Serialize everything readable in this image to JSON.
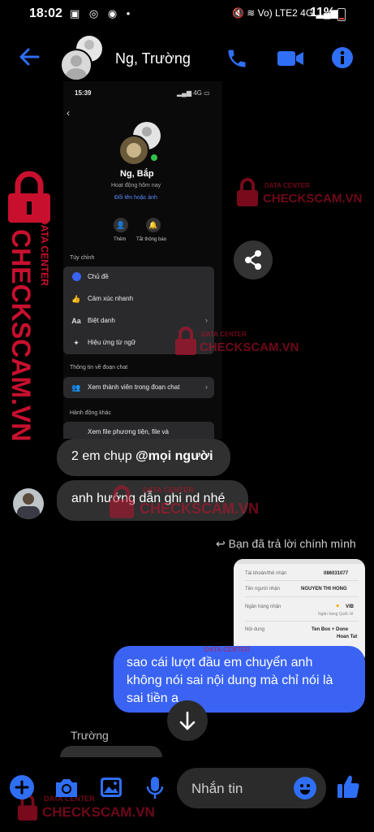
{
  "status_bar": {
    "time": "18:02",
    "network_label": "Vo) LTE2 4G",
    "battery": "11%"
  },
  "header": {
    "contact_name": "Ng, Trường"
  },
  "embedded": {
    "time": "15:39",
    "signal": "4G",
    "profile_name": "Ng, Bắp",
    "status": "Hoạt động hôm nay",
    "rename_link": "Đổi tên hoặc ảnh",
    "add_label": "Thêm",
    "mute_label": "Tắt thông báo",
    "section_customize": "Tùy chỉnh",
    "customize_items": [
      {
        "icon": "theme-icon",
        "label": "Chủ đề"
      },
      {
        "icon": "like-icon",
        "label": "Cảm xúc nhanh"
      },
      {
        "icon": "nickname-icon",
        "label": "Biệt danh",
        "glyph": "Aa"
      },
      {
        "icon": "effects-icon",
        "label": "Hiệu ứng từ ngữ"
      }
    ],
    "section_info": "Thông tin về đoạn chat",
    "members_label": "Xem thành viên trong đoạn chat",
    "section_other": "Hành động khác",
    "media_label": "Xem file phương tiện, file và"
  },
  "messages": {
    "msg1_prefix": "2 em chụp ",
    "msg1_mention": "@mọi người",
    "msg2": "anh hướng dẫn ghi nd nhé",
    "reply_note": "Bạn đã trả lời chính mình",
    "outgoing": [
      "sao cái lượt đầu em chuyển anh",
      "không nói sai nội dung mà chỉ nói là",
      "sai tiền a"
    ],
    "sender_name": "Trường"
  },
  "receipt": {
    "rows": [
      {
        "label": "Tài khoản/thẻ nhận",
        "value": "086031077"
      },
      {
        "label": "Tên người nhận",
        "value": "NGUYEN THI HONG"
      },
      {
        "label": "Ngân hàng nhận",
        "value": "VIB"
      },
      {
        "label": "Nội dung",
        "value": "Ten Box + Done",
        "value2": "Hoan Tat"
      }
    ],
    "bank_sub": "Ngân hàng Quốc tế"
  },
  "composer": {
    "placeholder": "Nhắn tin"
  },
  "watermark": {
    "title": "DATA CENTER",
    "brand": "CHECKSCAM.VN"
  },
  "colors": {
    "accent": "#2f6ff5",
    "outgoing_bubble": "#3a63f3",
    "incoming_bubble": "#303030",
    "watermark": "#c8102e"
  }
}
